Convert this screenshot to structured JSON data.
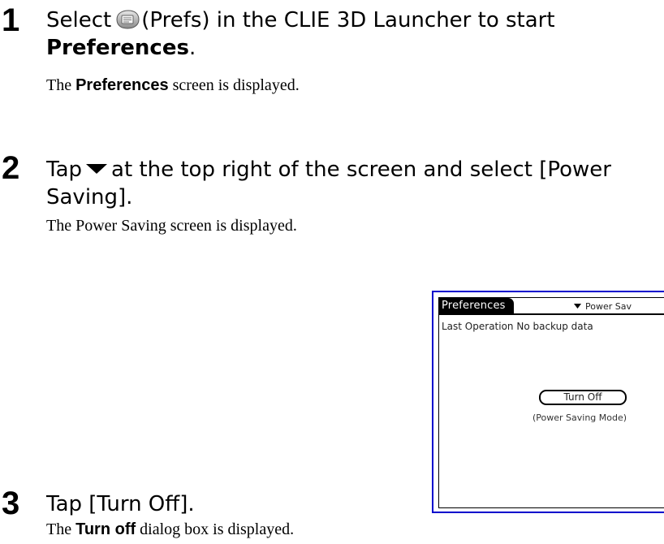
{
  "steps": [
    {
      "number": "1",
      "heading_pre": "Select",
      "heading_mid": "(Prefs) in the CLIE 3D Launcher to start",
      "heading_bold": "Preferences",
      "heading_end": ".",
      "desc_pre": "The",
      "desc_bold": "Preferences",
      "desc_post": "screen is displayed.",
      "icon": "prefs-icon"
    },
    {
      "number": "2",
      "heading_pre": "Tap",
      "heading_post": "at the top right of the screen and select [Power Saving].",
      "desc": "The Power Saving screen is displayed.",
      "icon": "dropdown-triangle-icon"
    },
    {
      "number": "3",
      "heading": "Tap [Turn Off].",
      "desc_pre": "The",
      "desc_bold": "Turn off",
      "desc_post": "dialog box is displayed."
    }
  ],
  "device_screen": {
    "title": "Preferences",
    "dropdown_label": "Power Sav",
    "status_text": "Last Operation No backup data",
    "button_label": "Turn Off",
    "caption": "(Power Saving Mode)"
  },
  "colors": {
    "panel_border": "#0000cc",
    "title_bg": "#000000"
  }
}
